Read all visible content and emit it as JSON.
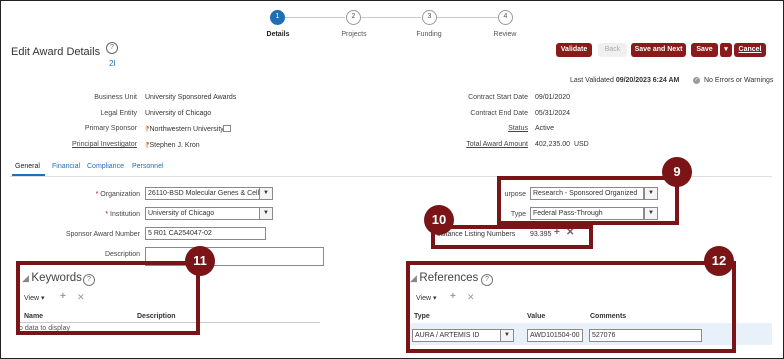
{
  "train": {
    "stops": [
      {
        "number": "1",
        "label": "Details"
      },
      {
        "number": "2",
        "label": "Projects"
      },
      {
        "number": "3",
        "label": "Funding"
      },
      {
        "number": "4",
        "label": "Review"
      }
    ]
  },
  "header": {
    "title": "Edit Award Details",
    "award_link": "2I",
    "buttons": {
      "validate": "Validate",
      "back": "Back",
      "save_next": "Save and Next",
      "save": "Save",
      "cancel": "Cancel"
    },
    "last_validated_label": "Last Validated",
    "last_validated_value": "09/20/2023 6:24 AM",
    "no_errors": "No Errors or Warnings"
  },
  "summary": {
    "business_unit_label": "Business Unit",
    "business_unit": "University Sponsored Awards",
    "legal_entity_label": "Legal Entity",
    "legal_entity": "University of Chicago",
    "primary_sponsor_label": "Primary Sponsor",
    "primary_sponsor": "Northwestern University",
    "principal_investigator_label": "Principal Investigator",
    "principal_investigator": "Stephen J. Kron",
    "contract_start_label": "Contract Start Date",
    "contract_start": "09/01/2020",
    "contract_end_label": "Contract End Date",
    "contract_end": "05/31/2024",
    "status_label": "Status",
    "status": "Active",
    "total_amount_label": "Total Award Amount",
    "total_amount": "402,235.00",
    "currency": "USD"
  },
  "tabs": [
    "General",
    "Financial",
    "Compliance",
    "Personnel"
  ],
  "general": {
    "organization_label": "Organization",
    "organization": "26110-BSD Molecular Genes & Cell",
    "institution_label": "Institution",
    "institution": "University of Chicago",
    "sponsor_award_number_label": "Sponsor Award Number",
    "sponsor_award_number": "5 R01 CA254047-02",
    "description_label": "Description",
    "purpose_label": "urpose",
    "purpose": "Research - Sponsored Organized",
    "type_label": "Type",
    "type": "Federal Pass-Through",
    "assistance_label": "sistance Listing Numbers",
    "assistance_value": "93.395"
  },
  "keywords": {
    "title": "Keywords",
    "view_label": "View",
    "col_name": "Name",
    "col_description": "Description",
    "empty": "o data to display"
  },
  "references": {
    "title": "References",
    "view_label": "View",
    "col_type": "Type",
    "col_value": "Value",
    "col_comments": "Comments",
    "row_type": "AURA / ARTEMIS ID",
    "row_value": "AWD101504-00",
    "row_comments": "527076"
  },
  "callouts": [
    "9",
    "10",
    "11",
    "12"
  ],
  "colors": {
    "accent": "#8b1a1a",
    "callout": "#7a1416",
    "link": "#1f6fb5",
    "train_active": "#1f6fb5"
  }
}
